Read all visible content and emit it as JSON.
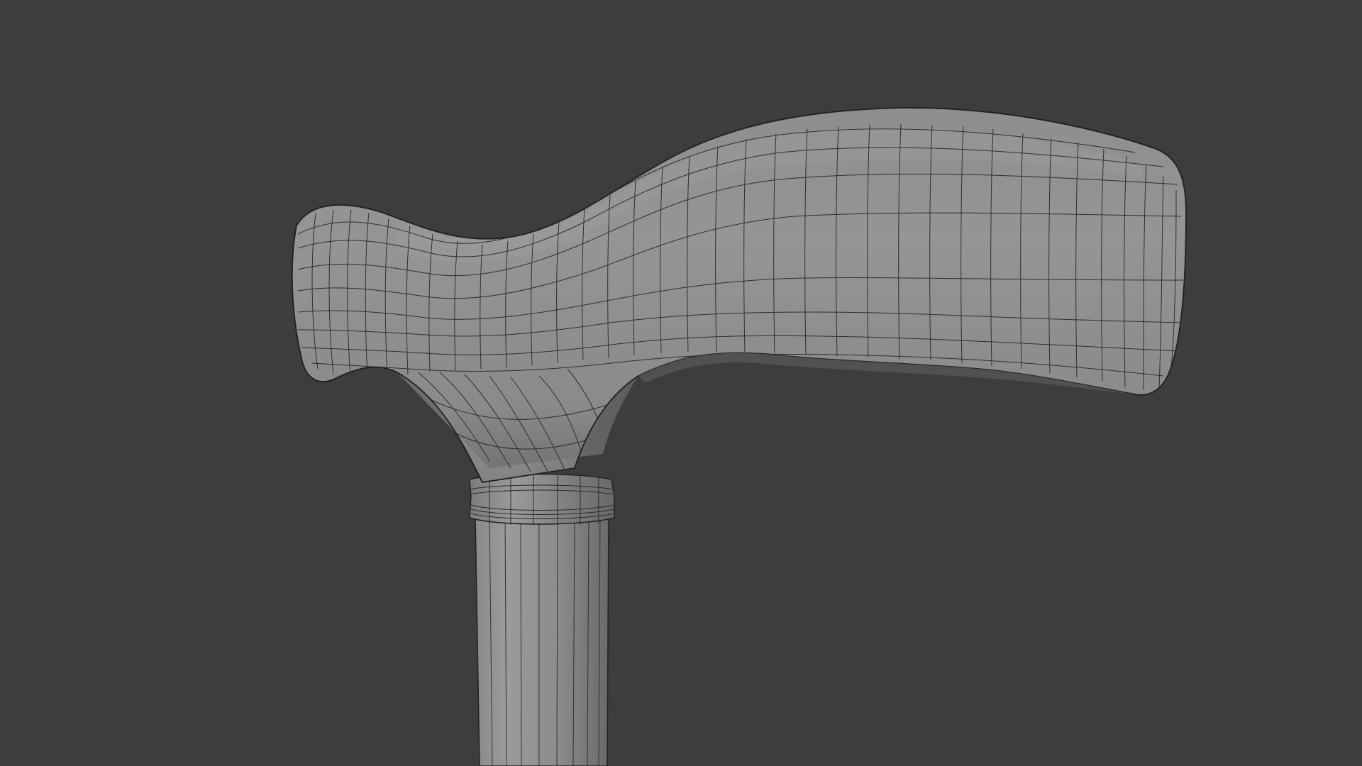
{
  "viewport": {
    "background_color": "#3d3d3d",
    "subject": "cane-handle-mesh"
  },
  "model": {
    "surface_color": "#8f8f8f",
    "wire_color": "#2a2a2a",
    "shading": "solid-with-wireframe"
  }
}
